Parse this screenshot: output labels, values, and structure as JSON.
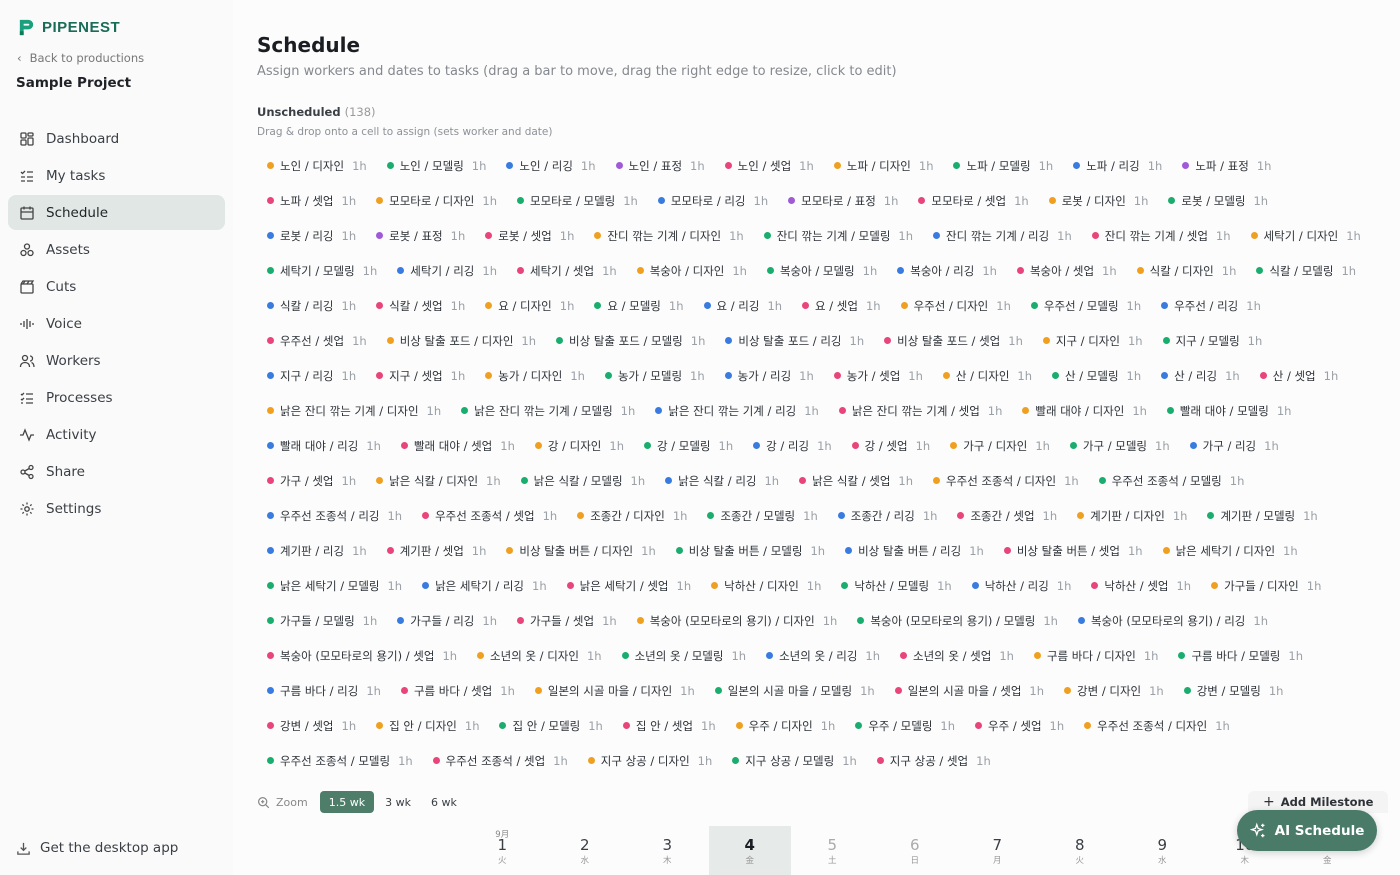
{
  "app": {
    "name": "PIPENEST",
    "back_label": "Back to productions",
    "project": "Sample Project"
  },
  "nav": [
    {
      "label": "Dashboard",
      "icon": "dashboard-icon"
    },
    {
      "label": "My tasks",
      "icon": "tasks-icon"
    },
    {
      "label": "Schedule",
      "icon": "schedule-icon",
      "active": true
    },
    {
      "label": "Assets",
      "icon": "assets-icon"
    },
    {
      "label": "Cuts",
      "icon": "cuts-icon"
    },
    {
      "label": "Voice",
      "icon": "voice-icon"
    },
    {
      "label": "Workers",
      "icon": "workers-icon"
    },
    {
      "label": "Processes",
      "icon": "processes-icon"
    },
    {
      "label": "Activity",
      "icon": "activity-icon"
    },
    {
      "label": "Share",
      "icon": "share-icon"
    },
    {
      "label": "Settings",
      "icon": "settings-icon"
    }
  ],
  "desktop_app_label": "Get the desktop app",
  "page": {
    "title": "Schedule",
    "subtitle": "Assign workers and dates to tasks (drag a bar to move, drag the right edge to resize, click to edit)"
  },
  "unscheduled": {
    "title": "Unscheduled",
    "count": "(138)",
    "hint": "Drag & drop onto a cell to assign (sets worker and date)"
  },
  "colors": {
    "디자인": "#f0a020",
    "모델링": "#1aad6e",
    "리깅": "#3a7be0",
    "표정": "#a05ad8",
    "셋업": "#e8457a",
    "accent": "#4a7a68"
  },
  "tasks": [
    {
      "label": "노인 / 디자인",
      "hrs": "1h",
      "type": "디자인"
    },
    {
      "label": "노인 / 모델링",
      "hrs": "1h",
      "type": "모델링"
    },
    {
      "label": "노인 / 리깅",
      "hrs": "1h",
      "type": "리깅"
    },
    {
      "label": "노인 / 표정",
      "hrs": "1h",
      "type": "표정"
    },
    {
      "label": "노인 / 셋업",
      "hrs": "1h",
      "type": "셋업"
    },
    {
      "label": "노파 / 디자인",
      "hrs": "1h",
      "type": "디자인"
    },
    {
      "label": "노파 / 모델링",
      "hrs": "1h",
      "type": "모델링"
    },
    {
      "label": "노파 / 리깅",
      "hrs": "1h",
      "type": "리깅"
    },
    {
      "label": "노파 / 표정",
      "hrs": "1h",
      "type": "표정"
    },
    {
      "label": "노파 / 셋업",
      "hrs": "1h",
      "type": "셋업"
    },
    {
      "label": "모모타로 / 디자인",
      "hrs": "1h",
      "type": "디자인"
    },
    {
      "label": "모모타로 / 모델링",
      "hrs": "1h",
      "type": "모델링"
    },
    {
      "label": "모모타로 / 리깅",
      "hrs": "1h",
      "type": "리깅"
    },
    {
      "label": "모모타로 / 표정",
      "hrs": "1h",
      "type": "표정"
    },
    {
      "label": "모모타로 / 셋업",
      "hrs": "1h",
      "type": "셋업"
    },
    {
      "label": "로봇 / 디자인",
      "hrs": "1h",
      "type": "디자인"
    },
    {
      "label": "로봇 / 모델링",
      "hrs": "1h",
      "type": "모델링"
    },
    {
      "label": "로봇 / 리깅",
      "hrs": "1h",
      "type": "리깅"
    },
    {
      "label": "로봇 / 표정",
      "hrs": "1h",
      "type": "표정"
    },
    {
      "label": "로봇 / 셋업",
      "hrs": "1h",
      "type": "셋업"
    },
    {
      "label": "잔디 깎는 기계 / 디자인",
      "hrs": "1h",
      "type": "디자인"
    },
    {
      "label": "잔디 깎는 기계 / 모델링",
      "hrs": "1h",
      "type": "모델링"
    },
    {
      "label": "잔디 깎는 기계 / 리깅",
      "hrs": "1h",
      "type": "리깅"
    },
    {
      "label": "잔디 깎는 기계 / 셋업",
      "hrs": "1h",
      "type": "셋업"
    },
    {
      "label": "세탁기 / 디자인",
      "hrs": "1h",
      "type": "디자인"
    },
    {
      "label": "세탁기 / 모델링",
      "hrs": "1h",
      "type": "모델링"
    },
    {
      "label": "세탁기 / 리깅",
      "hrs": "1h",
      "type": "리깅"
    },
    {
      "label": "세탁기 / 셋업",
      "hrs": "1h",
      "type": "셋업"
    },
    {
      "label": "복숭아 / 디자인",
      "hrs": "1h",
      "type": "디자인"
    },
    {
      "label": "복숭아 / 모델링",
      "hrs": "1h",
      "type": "모델링"
    },
    {
      "label": "복숭아 / 리깅",
      "hrs": "1h",
      "type": "리깅"
    },
    {
      "label": "복숭아 / 셋업",
      "hrs": "1h",
      "type": "셋업"
    },
    {
      "label": "식칼 / 디자인",
      "hrs": "1h",
      "type": "디자인"
    },
    {
      "label": "식칼 / 모델링",
      "hrs": "1h",
      "type": "모델링"
    },
    {
      "label": "식칼 / 리깅",
      "hrs": "1h",
      "type": "리깅"
    },
    {
      "label": "식칼 / 셋업",
      "hrs": "1h",
      "type": "셋업"
    },
    {
      "label": "요 / 디자인",
      "hrs": "1h",
      "type": "디자인"
    },
    {
      "label": "요 / 모델링",
      "hrs": "1h",
      "type": "모델링"
    },
    {
      "label": "요 / 리깅",
      "hrs": "1h",
      "type": "리깅"
    },
    {
      "label": "요 / 셋업",
      "hrs": "1h",
      "type": "셋업"
    },
    {
      "label": "우주선 / 디자인",
      "hrs": "1h",
      "type": "디자인"
    },
    {
      "label": "우주선 / 모델링",
      "hrs": "1h",
      "type": "모델링"
    },
    {
      "label": "우주선 / 리깅",
      "hrs": "1h",
      "type": "리깅"
    },
    {
      "label": "우주선 / 셋업",
      "hrs": "1h",
      "type": "셋업"
    },
    {
      "label": "비상 탈출 포드 / 디자인",
      "hrs": "1h",
      "type": "디자인"
    },
    {
      "label": "비상 탈출 포드 / 모델링",
      "hrs": "1h",
      "type": "모델링"
    },
    {
      "label": "비상 탈출 포드 / 리깅",
      "hrs": "1h",
      "type": "리깅"
    },
    {
      "label": "비상 탈출 포드 / 셋업",
      "hrs": "1h",
      "type": "셋업"
    },
    {
      "label": "지구 / 디자인",
      "hrs": "1h",
      "type": "디자인"
    },
    {
      "label": "지구 / 모델링",
      "hrs": "1h",
      "type": "모델링"
    },
    {
      "label": "지구 / 리깅",
      "hrs": "1h",
      "type": "리깅"
    },
    {
      "label": "지구 / 셋업",
      "hrs": "1h",
      "type": "셋업"
    },
    {
      "label": "농가 / 디자인",
      "hrs": "1h",
      "type": "디자인"
    },
    {
      "label": "농가 / 모델링",
      "hrs": "1h",
      "type": "모델링"
    },
    {
      "label": "농가 / 리깅",
      "hrs": "1h",
      "type": "리깅"
    },
    {
      "label": "농가 / 셋업",
      "hrs": "1h",
      "type": "셋업"
    },
    {
      "label": "산 / 디자인",
      "hrs": "1h",
      "type": "디자인"
    },
    {
      "label": "산 / 모델링",
      "hrs": "1h",
      "type": "모델링"
    },
    {
      "label": "산 / 리깅",
      "hrs": "1h",
      "type": "리깅"
    },
    {
      "label": "산 / 셋업",
      "hrs": "1h",
      "type": "셋업"
    },
    {
      "label": "낡은 잔디 깎는 기계 / 디자인",
      "hrs": "1h",
      "type": "디자인"
    },
    {
      "label": "낡은 잔디 깎는 기계 / 모델링",
      "hrs": "1h",
      "type": "모델링"
    },
    {
      "label": "낡은 잔디 깎는 기계 / 리깅",
      "hrs": "1h",
      "type": "리깅"
    },
    {
      "label": "낡은 잔디 깎는 기계 / 셋업",
      "hrs": "1h",
      "type": "셋업"
    },
    {
      "label": "빨래 대야 / 디자인",
      "hrs": "1h",
      "type": "디자인"
    },
    {
      "label": "빨래 대야 / 모델링",
      "hrs": "1h",
      "type": "모델링"
    },
    {
      "label": "빨래 대야 / 리깅",
      "hrs": "1h",
      "type": "리깅"
    },
    {
      "label": "빨래 대야 / 셋업",
      "hrs": "1h",
      "type": "셋업"
    },
    {
      "label": "강 / 디자인",
      "hrs": "1h",
      "type": "디자인"
    },
    {
      "label": "강 / 모델링",
      "hrs": "1h",
      "type": "모델링"
    },
    {
      "label": "강 / 리깅",
      "hrs": "1h",
      "type": "리깅"
    },
    {
      "label": "강 / 셋업",
      "hrs": "1h",
      "type": "셋업"
    },
    {
      "label": "가구 / 디자인",
      "hrs": "1h",
      "type": "디자인"
    },
    {
      "label": "가구 / 모델링",
      "hrs": "1h",
      "type": "모델링"
    },
    {
      "label": "가구 / 리깅",
      "hrs": "1h",
      "type": "리깅"
    },
    {
      "label": "가구 / 셋업",
      "hrs": "1h",
      "type": "셋업"
    },
    {
      "label": "낡은 식칼 / 디자인",
      "hrs": "1h",
      "type": "디자인"
    },
    {
      "label": "낡은 식칼 / 모델링",
      "hrs": "1h",
      "type": "모델링"
    },
    {
      "label": "낡은 식칼 / 리깅",
      "hrs": "1h",
      "type": "리깅"
    },
    {
      "label": "낡은 식칼 / 셋업",
      "hrs": "1h",
      "type": "셋업"
    },
    {
      "label": "우주선 조종석 / 디자인",
      "hrs": "1h",
      "type": "디자인"
    },
    {
      "label": "우주선 조종석 / 모델링",
      "hrs": "1h",
      "type": "모델링"
    },
    {
      "label": "우주선 조종석 / 리깅",
      "hrs": "1h",
      "type": "리깅"
    },
    {
      "label": "우주선 조종석 / 셋업",
      "hrs": "1h",
      "type": "셋업"
    },
    {
      "label": "조종간 / 디자인",
      "hrs": "1h",
      "type": "디자인"
    },
    {
      "label": "조종간 / 모델링",
      "hrs": "1h",
      "type": "모델링"
    },
    {
      "label": "조종간 / 리깅",
      "hrs": "1h",
      "type": "리깅"
    },
    {
      "label": "조종간 / 셋업",
      "hrs": "1h",
      "type": "셋업"
    },
    {
      "label": "계기판 / 디자인",
      "hrs": "1h",
      "type": "디자인"
    },
    {
      "label": "계기판 / 모델링",
      "hrs": "1h",
      "type": "모델링"
    },
    {
      "label": "계기판 / 리깅",
      "hrs": "1h",
      "type": "리깅"
    },
    {
      "label": "계기판 / 셋업",
      "hrs": "1h",
      "type": "셋업"
    },
    {
      "label": "비상 탈출 버튼 / 디자인",
      "hrs": "1h",
      "type": "디자인"
    },
    {
      "label": "비상 탈출 버튼 / 모델링",
      "hrs": "1h",
      "type": "모델링"
    },
    {
      "label": "비상 탈출 버튼 / 리깅",
      "hrs": "1h",
      "type": "리깅"
    },
    {
      "label": "비상 탈출 버튼 / 셋업",
      "hrs": "1h",
      "type": "셋업"
    },
    {
      "label": "낡은 세탁기 / 디자인",
      "hrs": "1h",
      "type": "디자인"
    },
    {
      "label": "낡은 세탁기 / 모델링",
      "hrs": "1h",
      "type": "모델링"
    },
    {
      "label": "낡은 세탁기 / 리깅",
      "hrs": "1h",
      "type": "리깅"
    },
    {
      "label": "낡은 세탁기 / 셋업",
      "hrs": "1h",
      "type": "셋업"
    },
    {
      "label": "낙하산 / 디자인",
      "hrs": "1h",
      "type": "디자인"
    },
    {
      "label": "낙하산 / 모델링",
      "hrs": "1h",
      "type": "모델링"
    },
    {
      "label": "낙하산 / 리깅",
      "hrs": "1h",
      "type": "리깅"
    },
    {
      "label": "낙하산 / 셋업",
      "hrs": "1h",
      "type": "셋업"
    },
    {
      "label": "가구들 / 디자인",
      "hrs": "1h",
      "type": "디자인"
    },
    {
      "label": "가구들 / 모델링",
      "hrs": "1h",
      "type": "모델링"
    },
    {
      "label": "가구들 / 리깅",
      "hrs": "1h",
      "type": "리깅"
    },
    {
      "label": "가구들 / 셋업",
      "hrs": "1h",
      "type": "셋업"
    },
    {
      "label": "복숭아 (모모타로의 용기) / 디자인",
      "hrs": "1h",
      "type": "디자인"
    },
    {
      "label": "복숭아 (모모타로의 용기) / 모델링",
      "hrs": "1h",
      "type": "모델링"
    },
    {
      "label": "복숭아 (모모타로의 용기) / 리깅",
      "hrs": "1h",
      "type": "리깅"
    },
    {
      "label": "복숭아 (모모타로의 용기) / 셋업",
      "hrs": "1h",
      "type": "셋업"
    },
    {
      "label": "소년의 옷 / 디자인",
      "hrs": "1h",
      "type": "디자인"
    },
    {
      "label": "소년의 옷 / 모델링",
      "hrs": "1h",
      "type": "모델링"
    },
    {
      "label": "소년의 옷 / 리깅",
      "hrs": "1h",
      "type": "리깅"
    },
    {
      "label": "소년의 옷 / 셋업",
      "hrs": "1h",
      "type": "셋업"
    },
    {
      "label": "구름 바다 / 디자인",
      "hrs": "1h",
      "type": "디자인"
    },
    {
      "label": "구름 바다 / 모델링",
      "hrs": "1h",
      "type": "모델링"
    },
    {
      "label": "구름 바다 / 리깅",
      "hrs": "1h",
      "type": "리깅"
    },
    {
      "label": "구름 바다 / 셋업",
      "hrs": "1h",
      "type": "셋업"
    },
    {
      "label": "일본의 시골 마을 / 디자인",
      "hrs": "1h",
      "type": "디자인"
    },
    {
      "label": "일본의 시골 마을 / 모델링",
      "hrs": "1h",
      "type": "모델링"
    },
    {
      "label": "일본의 시골 마을 / 셋업",
      "hrs": "1h",
      "type": "셋업"
    },
    {
      "label": "강변 / 디자인",
      "hrs": "1h",
      "type": "디자인"
    },
    {
      "label": "강변 / 모델링",
      "hrs": "1h",
      "type": "모델링"
    },
    {
      "label": "강변 / 셋업",
      "hrs": "1h",
      "type": "셋업"
    },
    {
      "label": "집 안 / 디자인",
      "hrs": "1h",
      "type": "디자인"
    },
    {
      "label": "집 안 / 모델링",
      "hrs": "1h",
      "type": "모델링"
    },
    {
      "label": "집 안 / 셋업",
      "hrs": "1h",
      "type": "셋업"
    },
    {
      "label": "우주 / 디자인",
      "hrs": "1h",
      "type": "디자인"
    },
    {
      "label": "우주 / 모델링",
      "hrs": "1h",
      "type": "모델링"
    },
    {
      "label": "우주 / 셋업",
      "hrs": "1h",
      "type": "셋업"
    },
    {
      "label": "우주선 조종석 / 디자인",
      "hrs": "1h",
      "type": "디자인"
    },
    {
      "label": "우주선 조종석 / 모델링",
      "hrs": "1h",
      "type": "모델링"
    },
    {
      "label": "우주선 조종석 / 셋업",
      "hrs": "1h",
      "type": "셋업"
    },
    {
      "label": "지구 상공 / 디자인",
      "hrs": "1h",
      "type": "디자인"
    },
    {
      "label": "지구 상공 / 모델링",
      "hrs": "1h",
      "type": "모델링"
    },
    {
      "label": "지구 상공 / 셋업",
      "hrs": "1h",
      "type": "셋업"
    }
  ],
  "zoom": {
    "label": "Zoom",
    "options": [
      "1.5 wk",
      "3 wk",
      "6 wk"
    ],
    "selected": "1.5 wk"
  },
  "actions": {
    "add_milestone": "Add Milestone",
    "ai_schedule": "AI Schedule"
  },
  "calendar": [
    {
      "month": "9月",
      "num": "1",
      "dow": "火"
    },
    {
      "month": "",
      "num": "2",
      "dow": "水"
    },
    {
      "month": "",
      "num": "3",
      "dow": "木"
    },
    {
      "month": "",
      "num": "4",
      "dow": "金",
      "today": true
    },
    {
      "month": "",
      "num": "5",
      "dow": "土",
      "weekend": true
    },
    {
      "month": "",
      "num": "6",
      "dow": "日",
      "weekend": true
    },
    {
      "month": "",
      "num": "7",
      "dow": "月"
    },
    {
      "month": "",
      "num": "8",
      "dow": "火"
    },
    {
      "month": "",
      "num": "9",
      "dow": "水"
    },
    {
      "month": "",
      "num": "10",
      "dow": "木"
    },
    {
      "month": "",
      "num": "11",
      "dow": "金"
    }
  ]
}
